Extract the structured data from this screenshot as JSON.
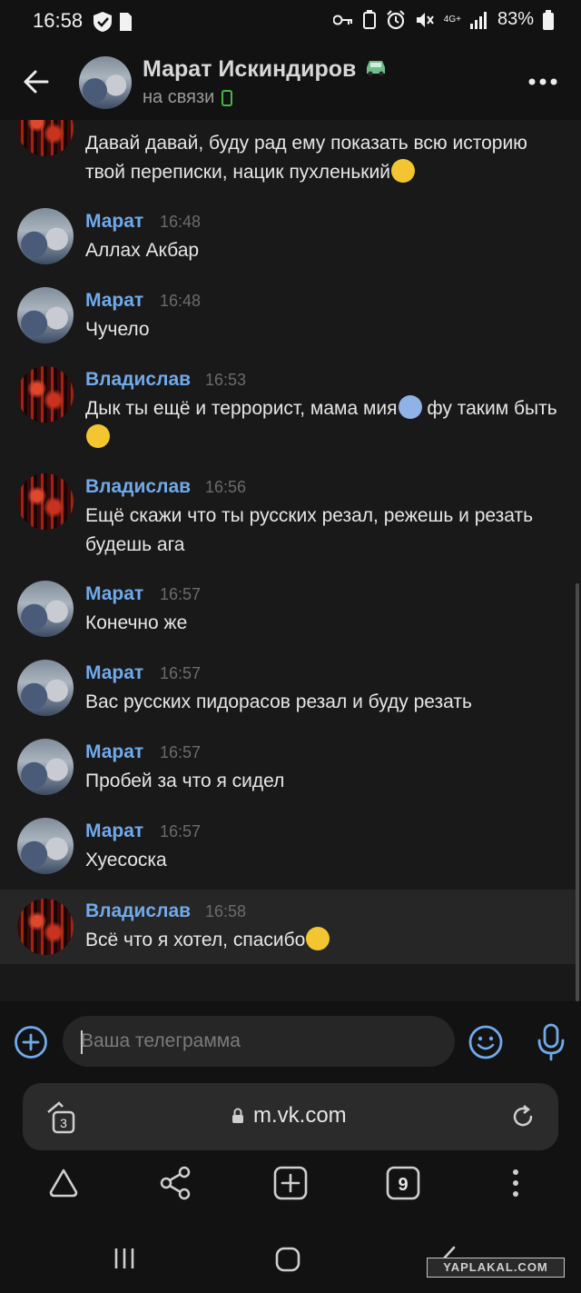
{
  "status_bar": {
    "time": "16:58",
    "battery": "83%",
    "network": "4G+"
  },
  "header": {
    "name": "Марат Искиндиров",
    "status": "на связи"
  },
  "messages": [
    {
      "from": "",
      "time": "",
      "text": "Давай давай, буду рад ему показать всю историю твой переписки, нацик пухленький"
    },
    {
      "from": "Марат",
      "time": "16:48",
      "text": "Аллах Акбар"
    },
    {
      "from": "Марат",
      "time": "16:48",
      "text": "Чучело"
    },
    {
      "from": "Владислав",
      "time": "16:53",
      "text": "Дык ты ещё и террорист, мама мия",
      "text2": " фу таким быть"
    },
    {
      "from": "Владислав",
      "time": "16:56",
      "text": "Ещё скажи что ты русских резал, режешь и резать будешь ага"
    },
    {
      "from": "Марат",
      "time": "16:57",
      "text": "Конечно же"
    },
    {
      "from": "Марат",
      "time": "16:57",
      "text": "Вас русских пидорасов резал и буду резать"
    },
    {
      "from": "Марат",
      "time": "16:57",
      "text": "Пробей за что я сидел"
    },
    {
      "from": "Марат",
      "time": "16:57",
      "text": "Хуесоска"
    },
    {
      "from": "Владислав",
      "time": "16:58",
      "text": "Всё что я хотел, спасибо"
    }
  ],
  "composer": {
    "placeholder": "Ваша телеграмма"
  },
  "browser": {
    "url": "m.vk.com",
    "tab_count": "3",
    "open_tabs": "9"
  },
  "watermark": "YAPLAKAL.COM",
  "colors": {
    "accent": "#71aaeb",
    "background": "#191919",
    "highlight": "#262626",
    "online": "#4bb34b"
  }
}
